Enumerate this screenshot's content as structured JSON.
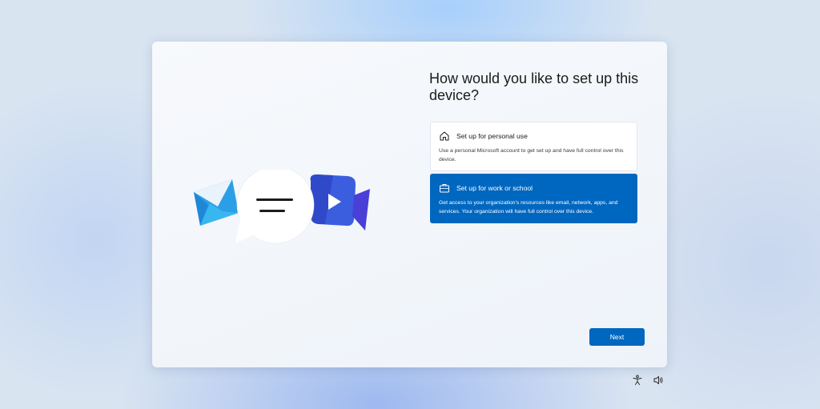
{
  "dialog": {
    "title": "How would you like to set up this device?"
  },
  "options": [
    {
      "title": "Set up for personal use",
      "description": "Use a personal Microsoft account to get set up and have full control over this device.",
      "icon": "home-icon",
      "selected": false
    },
    {
      "title": "Set up for work or school",
      "description": "Get access to your organization's resources like email, network, apps, and services. Your organization will have full control over this device.",
      "icon": "briefcase-icon",
      "selected": true
    }
  ],
  "actions": {
    "next_label": "Next"
  },
  "tray": {
    "icons": [
      "accessibility-icon",
      "volume-icon"
    ]
  },
  "colors": {
    "accent": "#0067c0",
    "background": "#d9e4f1",
    "window": "#f4f7fb"
  }
}
